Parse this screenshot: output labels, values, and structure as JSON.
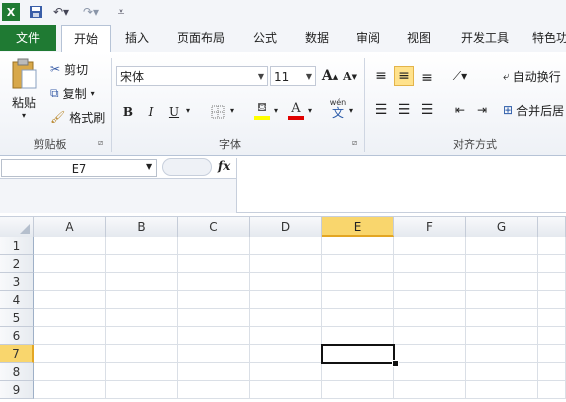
{
  "qat": {
    "excel_logo": "X",
    "save_icon": "save-icon",
    "undo_icon": "undo-icon",
    "redo_icon": "redo-icon",
    "customize_icon": "customize-icon"
  },
  "tabs": [
    "文件",
    "开始",
    "插入",
    "页面布局",
    "公式",
    "数据",
    "审阅",
    "视图",
    "开发工具",
    "特色功"
  ],
  "clipboard": {
    "paste": "粘贴",
    "cut": "剪切",
    "copy": "复制",
    "format_painter": "格式刷",
    "label": "剪贴板"
  },
  "font": {
    "name": "宋体",
    "size": "11",
    "grow": "A",
    "shrink": "A",
    "bold": "B",
    "italic": "I",
    "underline": "U",
    "wen": "wén",
    "wen_char": "文",
    "label": "字体",
    "colors": {
      "fill": "#ffff00",
      "text": "#e00000"
    }
  },
  "alignment": {
    "wrap_text": "自动换行",
    "merge_center": "合并后居",
    "label": "对齐方式"
  },
  "formula_bar": {
    "name_box": "E7",
    "fx": "fx"
  },
  "grid": {
    "columns": [
      "A",
      "B",
      "C",
      "D",
      "E",
      "F",
      "G"
    ],
    "rows": [
      "1",
      "2",
      "3",
      "4",
      "5",
      "6",
      "7",
      "8",
      "9"
    ],
    "active_col": "E",
    "active_row": "7"
  }
}
